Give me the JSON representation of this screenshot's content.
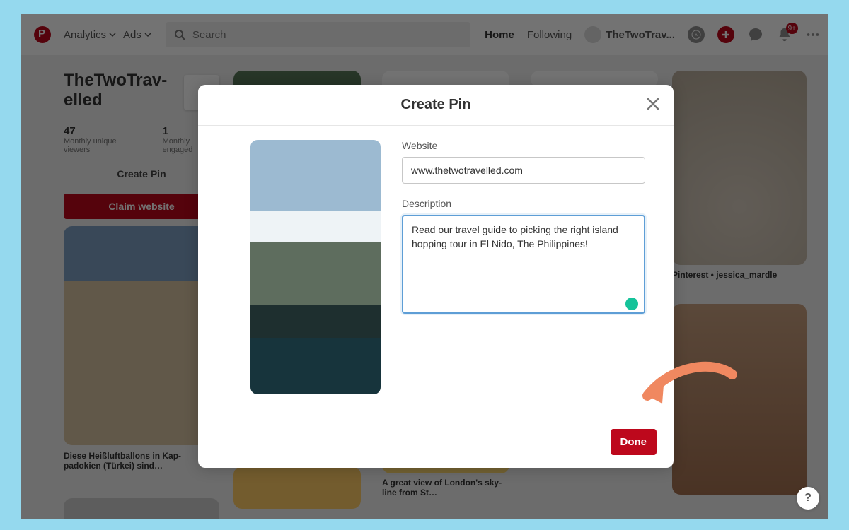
{
  "header": {
    "analytics": "Analytics",
    "ads": "Ads",
    "search_placeholder": "Search",
    "home": "Home",
    "following": "Following",
    "username": "TheTwoTrav...",
    "notif_count": "9+"
  },
  "profile": {
    "title": "TheTwoTrav-\nelled",
    "stat1_num": "47",
    "stat1_lbl": "Monthly unique viewers",
    "stat2_num": "1",
    "stat2_lbl": "Monthly engaged",
    "create_pin": "Create Pin",
    "claim": "Claim website"
  },
  "pins": {
    "cap1": "Diese Heißluftballons in Kap-\npadokien (Türkei) sind…",
    "cap5": "A great view of London's sky-\nline from St…",
    "cap6": "Pinterest • jessica_mardle"
  },
  "modal": {
    "title": "Create Pin",
    "website_label": "Website",
    "website_value": "www.thetwotravelled.com",
    "description_label": "Description",
    "description_value": "Read our travel guide to picking the right island hopping tour in El Nido, The Philippines! ",
    "done": "Done"
  },
  "help": "?"
}
